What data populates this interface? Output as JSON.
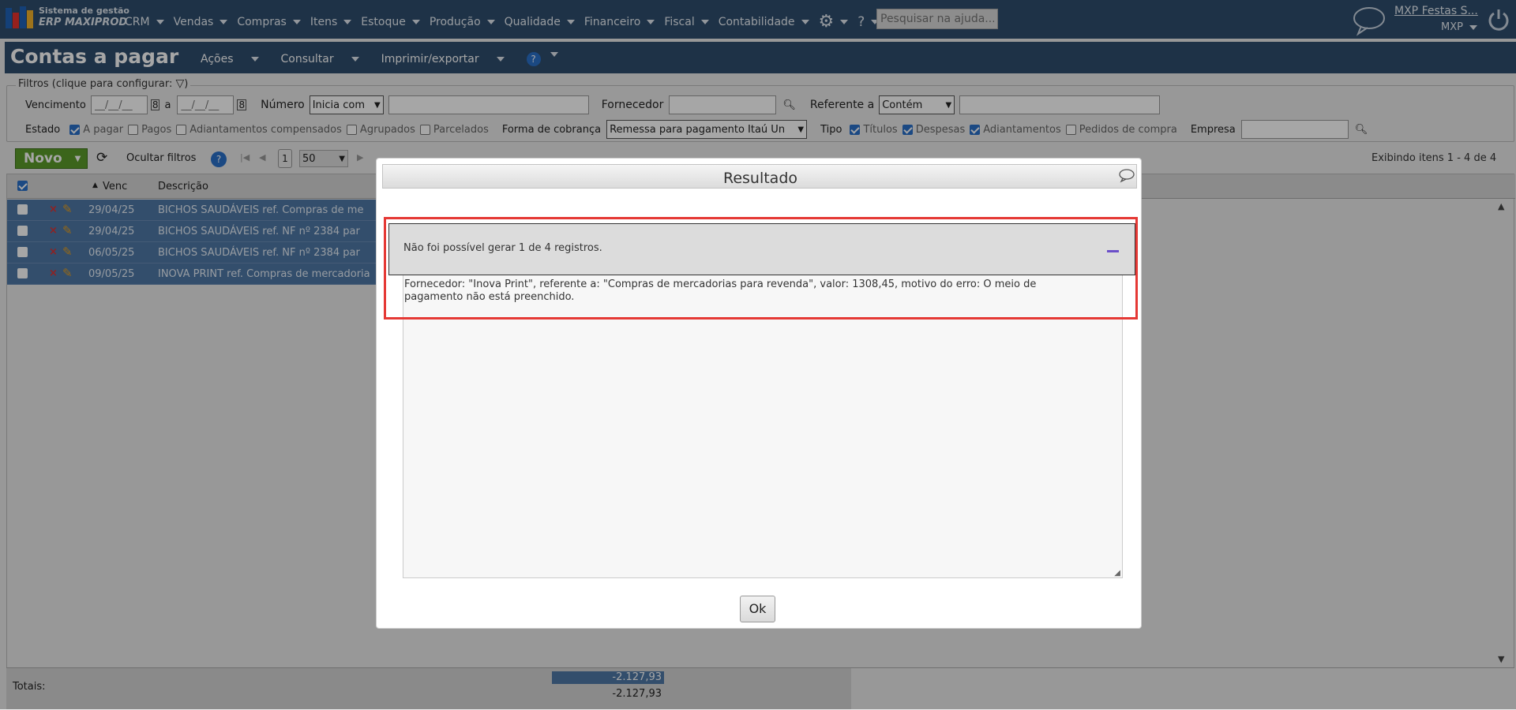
{
  "app": {
    "logo_line1": "Sistema de gestão",
    "logo_line2": "ERP MAXIPROD"
  },
  "nav": [
    "CRM",
    "Vendas",
    "Compras",
    "Itens",
    "Estoque",
    "Produção",
    "Qualidade",
    "Financeiro",
    "Fiscal",
    "Contabilidade"
  ],
  "help_search": {
    "placeholder": "Pesquisar na ajuda..."
  },
  "user": {
    "name": "MXP Festas S...",
    "company": "MXP"
  },
  "page": {
    "title": "Contas a pagar",
    "menu": [
      "Ações",
      "Consultar",
      "Imprimir/exportar"
    ]
  },
  "filters": {
    "legend": "Filtros (clique para configurar:",
    "vencimento_label": "Vencimento",
    "date_placeholder": "__/__/__",
    "a_label": "a",
    "numero_label": "Número",
    "numero_mode": "Inicia com",
    "fornecedor_label": "Fornecedor",
    "referente_label": "Referente a",
    "referente_mode": "Contém",
    "estado_label": "Estado",
    "estado_options": [
      {
        "label": "A pagar",
        "checked": true
      },
      {
        "label": "Pagos",
        "checked": false
      },
      {
        "label": "Adiantamentos compensados",
        "checked": false
      },
      {
        "label": "Agrupados",
        "checked": false
      },
      {
        "label": "Parcelados",
        "checked": false
      }
    ],
    "forma_label": "Forma de cobrança",
    "forma_value": "Remessa para pagamento Itaú Un",
    "tipo_label": "Tipo",
    "tipo_options": [
      {
        "label": "Títulos",
        "checked": true
      },
      {
        "label": "Despesas",
        "checked": true
      },
      {
        "label": "Adiantamentos",
        "checked": true
      },
      {
        "label": "Pedidos de compra",
        "checked": false
      }
    ],
    "empresa_label": "Empresa"
  },
  "toolbar": {
    "novo": "Novo",
    "hide_filters": "Ocultar filtros",
    "page": "1",
    "page_size": "50",
    "showing": "Exibindo itens 1 - 4 de 4"
  },
  "table": {
    "headers": {
      "venc": "Venc",
      "descricao": "Descrição"
    },
    "rows": [
      {
        "venc": "29/04/25",
        "desc": "BICHOS SAUDÁVEIS ref. Compras de me"
      },
      {
        "venc": "29/04/25",
        "desc": "BICHOS SAUDÁVEIS ref. NF nº 2384 par"
      },
      {
        "venc": "06/05/25",
        "desc": "BICHOS SAUDÁVEIS ref. NF nº 2384 par"
      },
      {
        "venc": "09/05/25",
        "desc": "INOVA PRINT ref. Compras de mercadoria"
      }
    ],
    "totals_label": "Totais:",
    "total_selected": "-2.127,93",
    "total_all": "-2.127,93"
  },
  "modal": {
    "title": "Resultado",
    "summary": "Não foi possível gerar 1 de 4 registros.",
    "detail_line1": "Fornecedor: \"Inova Print\", referente a: \"Compras de mercadorias para revenda\", valor: 1308,45, motivo do erro: O meio de",
    "detail_line2": "pagamento não está preenchido.",
    "ok": "Ok"
  },
  "colors": {
    "header_blue": "#2f4d6e",
    "row_blue": "#4f79a7",
    "novo_green": "#5b9b2a",
    "highlight_red": "#e53935"
  }
}
